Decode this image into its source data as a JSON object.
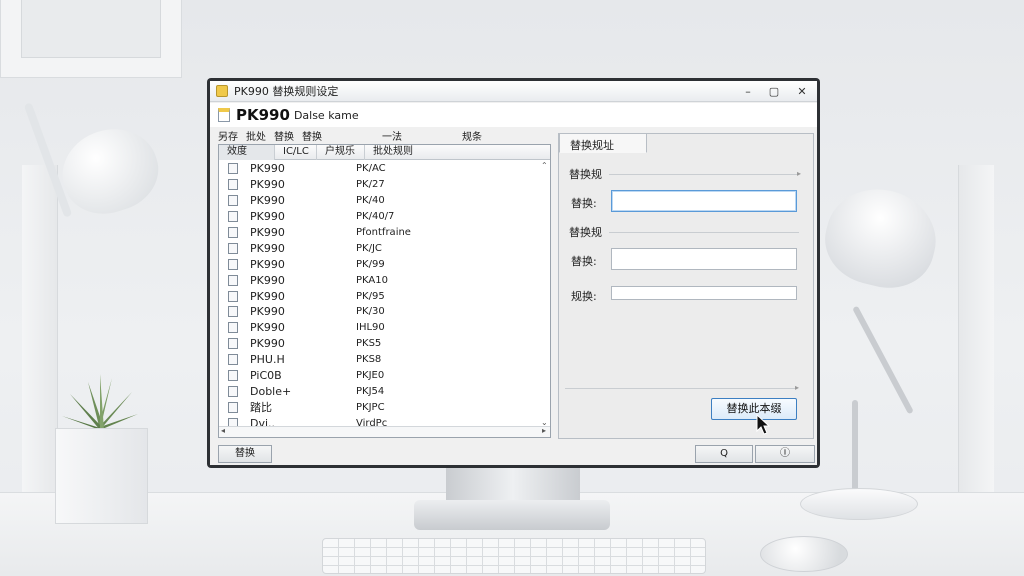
{
  "window": {
    "title": "PK990 替换规则设定",
    "app_name": "PK990",
    "app_subtitle": "Dalse kame",
    "controls": {
      "minimize": "–",
      "maximize": "▢",
      "close": "✕"
    }
  },
  "menu": [
    "另存",
    "批处",
    "替换",
    "替换",
    "一法",
    "规条"
  ],
  "list": {
    "columns": [
      "效度",
      "IC/LC",
      "户规乐",
      "批处规则"
    ],
    "rows": [
      {
        "name": "PK990",
        "code": "PK/AC"
      },
      {
        "name": "PK990",
        "code": "PK/27"
      },
      {
        "name": "PK990",
        "code": "PK/40"
      },
      {
        "name": "PK990",
        "code": "PK/40/7"
      },
      {
        "name": "PK990",
        "code": "Pfontfraine"
      },
      {
        "name": "PK990",
        "code": "PK/JC"
      },
      {
        "name": "PK990",
        "code": "PK/99"
      },
      {
        "name": "PK990",
        "code": "PKA10"
      },
      {
        "name": "PK990",
        "code": "PK/95"
      },
      {
        "name": "PK990",
        "code": "PK/30"
      },
      {
        "name": "PK990",
        "code": "IHL90"
      },
      {
        "name": "PK990",
        "code": "PKS5"
      },
      {
        "name": "PHU.H",
        "code": "PKS8"
      },
      {
        "name": "PiC0B",
        "code": "PKJE0"
      },
      {
        "name": "Doble+",
        "code": "PKJ54"
      },
      {
        "name": "踏比",
        "code": "PKJPC"
      },
      {
        "name": "Dvi..",
        "code": "VirdPc"
      }
    ]
  },
  "panel": {
    "tab_label": "替换规址",
    "section1_title": "替换规",
    "field1_label": "替换:",
    "field1_value": "",
    "section2_title": "替换规",
    "field2_label": "替换:",
    "field2_value": "",
    "field3_label": "规换:",
    "field3_value": "",
    "apply_label": "替换此本缀"
  },
  "footer": {
    "left_button": "替换",
    "ok_button": "Q",
    "cancel_button": "Ⓘ"
  },
  "colors": {
    "accent": "#3c7fc2",
    "focus": "#5a9ad8",
    "window_bg": "#f0f0f0",
    "folder_icon": "#f0c94a"
  }
}
